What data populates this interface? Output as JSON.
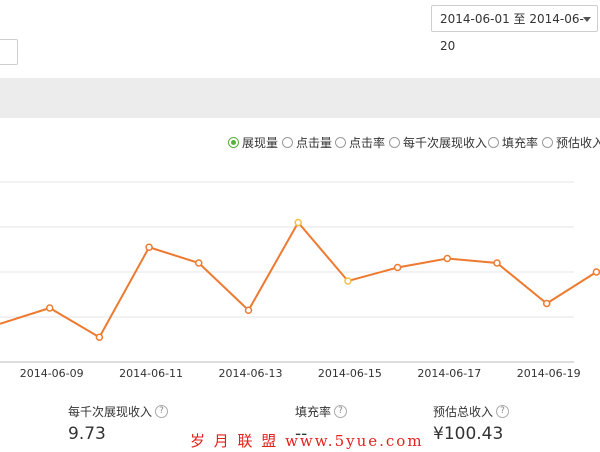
{
  "date_range": {
    "label": "2014-06-01 至 2014-06-20"
  },
  "metrics": [
    {
      "label": "展现量",
      "checked": true
    },
    {
      "label": "点击量",
      "checked": false
    },
    {
      "label": "点击率",
      "checked": false
    },
    {
      "label": "每千次展现收入",
      "checked": false
    },
    {
      "label": "填充率",
      "checked": false
    },
    {
      "label": "预估收入",
      "checked": false
    }
  ],
  "chart_data": {
    "type": "line",
    "x_tick_labels": [
      "2014-06-09",
      "2014-06-11",
      "2014-06-13",
      "2014-06-15",
      "2014-06-17",
      "2014-06-19"
    ],
    "x": [
      "2014-06-08",
      "2014-06-09",
      "2014-06-10",
      "2014-06-11",
      "2014-06-12",
      "2014-06-13",
      "2014-06-14",
      "2014-06-15",
      "2014-06-16",
      "2014-06-17",
      "2014-06-18",
      "2014-06-19",
      "2014-06-20"
    ],
    "values": [
      1.7,
      2.4,
      1.1,
      5.1,
      4.4,
      2.3,
      6.2,
      3.6,
      4.2,
      4.6,
      4.4,
      2.6,
      4.0
    ],
    "highlight": [
      "2014-06-14",
      "2014-06-15"
    ],
    "ylim": [
      0,
      8
    ],
    "grid": true,
    "line_color": "#ee7a30",
    "highlight_color": "#f2c04a"
  },
  "summary": [
    {
      "label": "每千次展现收入",
      "value": "9.73"
    },
    {
      "label": "填充率",
      "value": "--"
    },
    {
      "label": "预估总收入",
      "value": "¥100.43"
    }
  ],
  "watermark": "岁 月 联 盟 www.5yue.com"
}
